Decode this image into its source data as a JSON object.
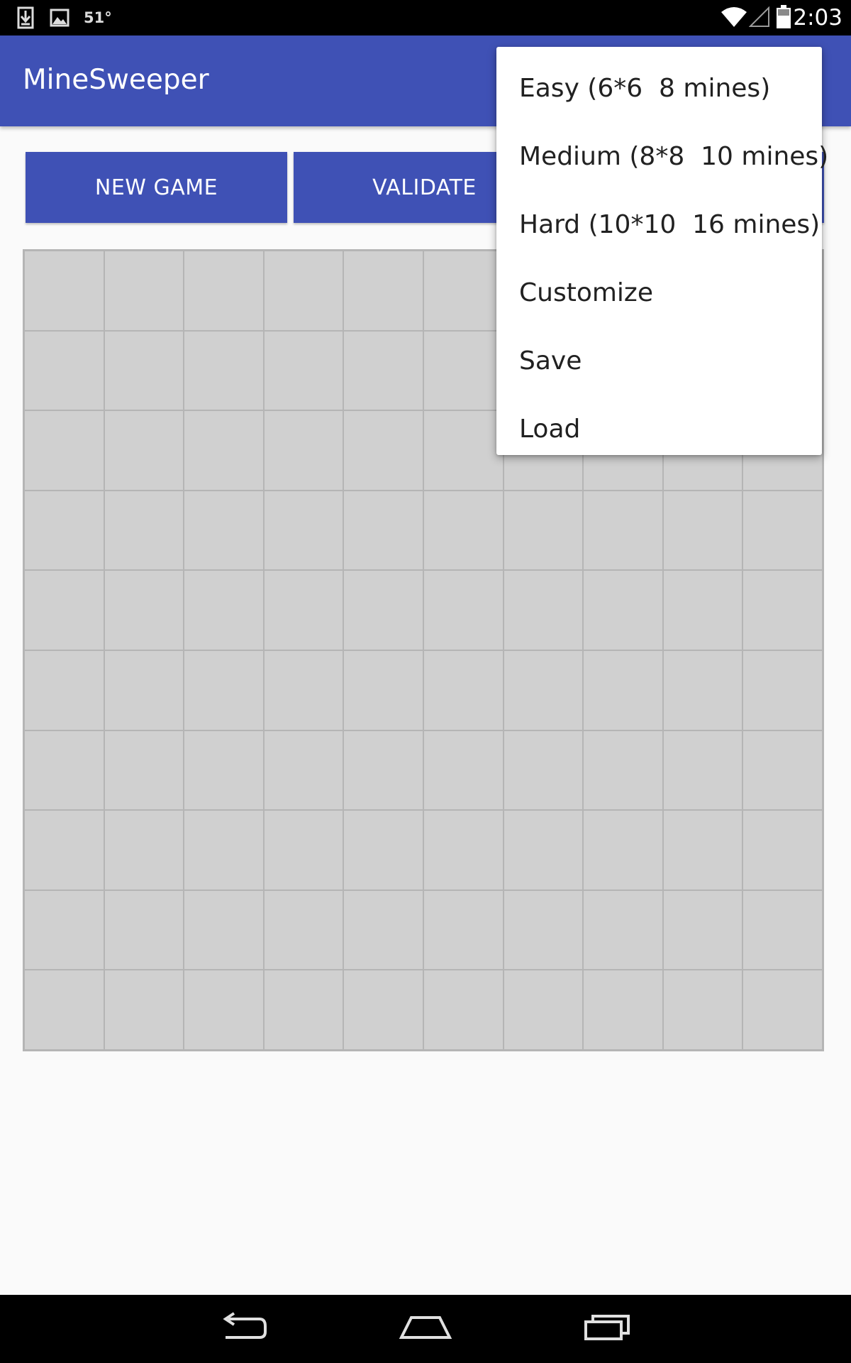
{
  "status_bar": {
    "temperature": "51°",
    "time": "2:03",
    "icons": [
      "download-icon",
      "image-icon",
      "wifi-icon",
      "cell-signal-icon",
      "battery-icon"
    ]
  },
  "app_bar": {
    "title": "MineSweeper",
    "color": "#3f51b5"
  },
  "toolbar": {
    "new_game_label": "NEW GAME",
    "validate_label": "VALIDATE"
  },
  "board": {
    "rows": 10,
    "columns": 10,
    "cell_color": "#d0d0d0"
  },
  "menu": {
    "items": [
      {
        "label": "Easy (6*6  8 mines)"
      },
      {
        "label": "Medium (8*8  10 mines)"
      },
      {
        "label": "Hard (10*10  16 mines)"
      },
      {
        "label": "Customize"
      },
      {
        "label": "Save"
      },
      {
        "label": "Load"
      }
    ]
  },
  "nav_bar": {
    "icons": [
      "back-icon",
      "home-icon",
      "recent-apps-icon"
    ]
  }
}
